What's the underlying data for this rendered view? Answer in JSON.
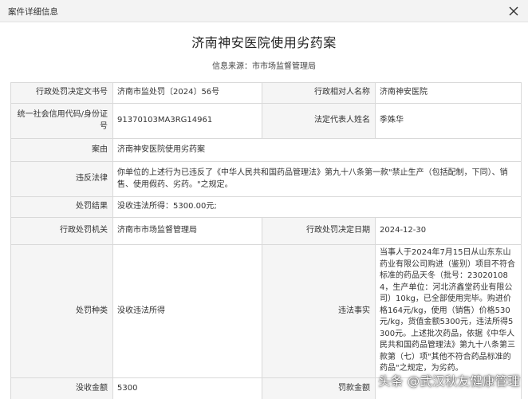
{
  "window": {
    "title": "案件详细信息",
    "close_icon": "close-icon"
  },
  "document": {
    "title": "济南神安医院使用劣药案",
    "source": "信息来源：市市场监督管理局"
  },
  "table": {
    "r1_label_a": "行政处罚决定文书号",
    "r1_value_a": "济南市监处罚〔2024〕56号",
    "r1_label_b": "行政相对人名称",
    "r1_value_b": "济南神安医院",
    "r2_label_a": "统一社会信用代码/身份证号",
    "r2_value_a": "91370103MA3RG14961",
    "r2_label_b": "法定代表人姓名",
    "r2_value_b": "季姝华",
    "r3_label": "案由",
    "r3_value": "济南神安医院使用劣药案",
    "r4_label": "违反法律",
    "r4_value": "你单位的上述行为已违反了《中华人民共和国药品管理法》第九十八条第一款\"禁止生产（包括配制，下同）、销售、使用假药、劣药。\"之规定。",
    "r5_label": "处罚结果",
    "r5_value": "没收违法所得：5300.00元;",
    "r6_label_a": "行政处罚机关",
    "r6_value_a": "济南市市场监督管理局",
    "r6_label_b": "行政处罚决定日期",
    "r6_value_b": "2024-12-30",
    "r7_label_a": "处罚种类",
    "r7_value_a": "没收违法所得",
    "r7_label_b": "违法事实",
    "r7_value_b": "当事人于2024年7月15日从山东东山药业有限公司购进（鉴别）项目不符合标准的药品天冬（批号：230201084，生产单位：河北济鑫堂药业有限公司）10kg，已全部使用完毕。购进价格164元/kg，使用（销售）价格530元/kg，货值金额5300元，违法所得5300元。上述批次药品，依据《中华人民共和国药品管理法》第九十八条第三款第（七）项\"其他不符合药品标准的药品\"之规定，为劣药。",
    "r8_label_a": "没收金额",
    "r8_value_a": "5300",
    "r8_label_b": "罚款金额",
    "r8_value_b": ""
  },
  "watermark": "头条 @武汉秋友健康管理"
}
